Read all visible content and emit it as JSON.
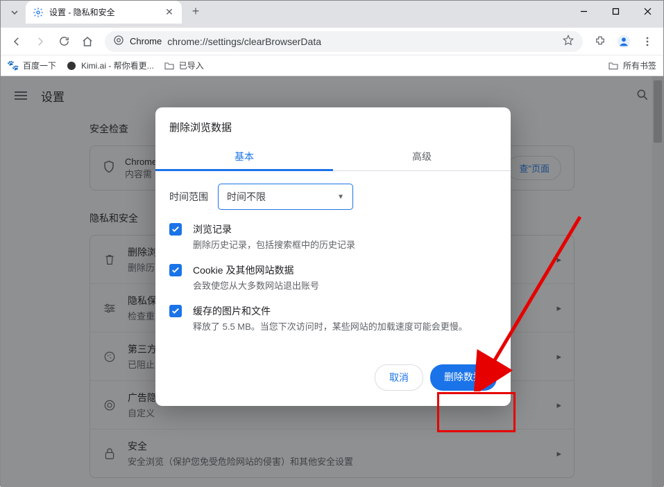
{
  "browser": {
    "tab_title": "设置 - 隐私和安全",
    "chrome_label": "Chrome",
    "url": "chrome://settings/clearBrowserData"
  },
  "bookmarks": {
    "items": [
      {
        "label": "百度一下"
      },
      {
        "label": "Kimi.ai - 帮你看更..."
      },
      {
        "label": "已导入"
      }
    ],
    "all_label": "所有书签"
  },
  "settings": {
    "title": "设置",
    "section1_title": "安全检查",
    "card_line1": "Chrome",
    "card_line2": "内容需",
    "card_button": "查\"页面",
    "section2_title": "隐私和安全",
    "rows": [
      {
        "t1": "删除浏",
        "t2": "删除历"
      },
      {
        "t1": "隐私保",
        "t2": "检查重"
      },
      {
        "t1": "第三方",
        "t2": "已阻止"
      },
      {
        "t1": "广告隐",
        "t2": "自定义"
      },
      {
        "t1": "安全",
        "t2": "安全浏览（保护您免受危险网站的侵害）和其他安全设置"
      }
    ]
  },
  "dialog": {
    "title": "删除浏览数据",
    "tab_basic": "基本",
    "tab_advanced": "高级",
    "range_label": "时间范围",
    "range_value": "时间不限",
    "checks": [
      {
        "t1": "浏览记录",
        "t2": "删除历史记录，包括搜索框中的历史记录"
      },
      {
        "t1": "Cookie 及其他网站数据",
        "t2": "会致使您从大多数网站退出账号"
      },
      {
        "t1": "缓存的图片和文件",
        "t2": "释放了 5.5 MB。当您下次访问时，某些网站的加载速度可能会更慢。"
      }
    ],
    "cancel": "取消",
    "confirm": "删除数据"
  }
}
